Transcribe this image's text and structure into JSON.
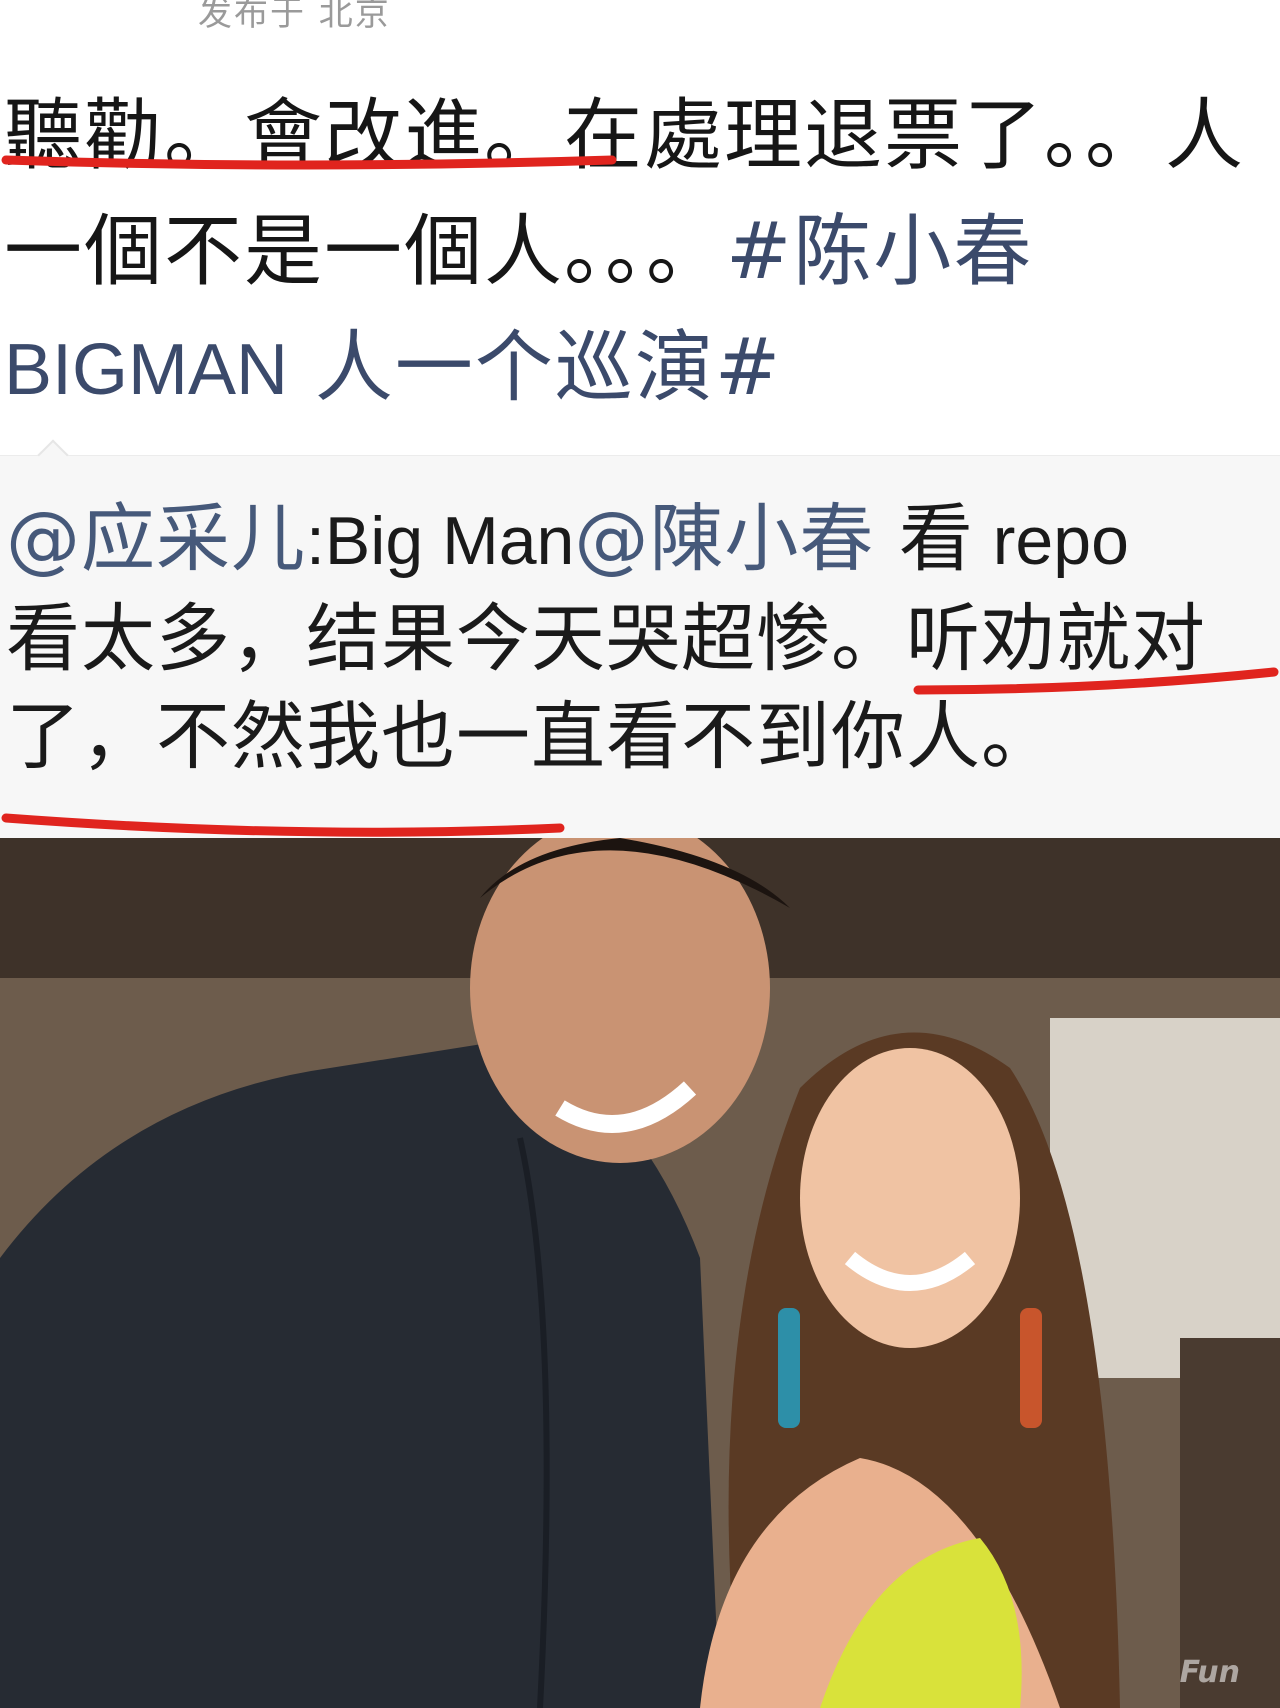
{
  "post": {
    "meta": "发布于 北京",
    "line1": "聽勸。會改進。在處理退票了。。人",
    "line2_prefix": "一個不是一個人。。。",
    "hashtag_a": "#陈小春",
    "hashtag_b_ascii": "BIGMAN",
    "hashtag_b_rest": " 人一个巡演#"
  },
  "quote": {
    "mention_user": "@应采儿",
    "text1_ascii": ":Big Man",
    "mention_target": "@陳小春",
    "text1_rest": " 看",
    "text1_repo": " repo",
    "line2": "看太多，结果今天哭超惨。听劝就对",
    "line3": "了，不然我也一直看不到你人。"
  },
  "photo": {
    "description_icon": "photo-image",
    "watermark": "Fun"
  },
  "colors": {
    "underline": "#e0241e",
    "hashtag": "#3b4a6b",
    "quote_bg": "#f7f7f7"
  }
}
